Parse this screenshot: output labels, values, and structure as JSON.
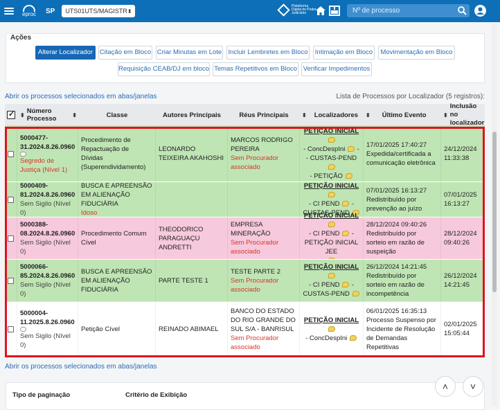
{
  "header": {
    "brand": "eproc",
    "uf": "SP",
    "unit_value": "UTS01UTS/MAGISTR",
    "pdpj_text": "Plataforma Digital do Poder Judiciário",
    "search_placeholder": "Nº de processo"
  },
  "acoes": {
    "title": "Ações",
    "buttons": [
      "Alterar Localizador",
      "Citação em Bloco",
      "Criar Minutas em Lote",
      "Incluir Lembretes em Bloco",
      "Intimação em Bloco",
      "Movimentação em Bloco",
      "Requisição CEAB/DJ em bloco",
      "Temas Repetitivos em Bloco",
      "Verificar Impedimentos"
    ]
  },
  "links": {
    "open_tabs": "Abrir os processos selecionados em abas/janelas"
  },
  "list_count": "Lista de Processos por Localizador (5 registros):",
  "table": {
    "headers": {
      "numero": "Número Processo",
      "classe": "Classe",
      "autores": "Autores Principais",
      "reus": "Réus Principais",
      "localizadores": "Localizadores",
      "evento": "Último Evento",
      "inclusao": "Inclusão no localizador"
    },
    "rows": [
      {
        "num1": "5000477-",
        "num2": "31.2024.8.26.0960",
        "sigilo": "Segredo de Justiça (Nível 1)",
        "classe": "Procedimento de Repactuação de Dívidas (Superendividamento)",
        "classe_extra": "",
        "autor": "LEONARDO TEIXEIRA AKAHOSHI",
        "reu": "MARCOS RODRIGO PEREIRA",
        "reu_note": "Sem Procurador associado",
        "loc_title": "PETIÇÃO INICIAL",
        "loc_1": "- ConcDespIni",
        "loc_2": "- CUSTAS-PEND",
        "loc_3": "- PETIÇÃO",
        "evento": "17/01/2025 17:40:27 Expedida/certificada a comunicação eletrônica",
        "inclusao": "24/12/2024 11:33:38"
      },
      {
        "num1": "5000409-",
        "num2": "81.2024.8.26.0960",
        "sigilo": "Sem Sigilo (Nível 0)",
        "classe": "BUSCA E APREENSÃO EM ALIENAÇÃO FIDUCIÁRIA",
        "classe_extra": "Idoso",
        "autor": "",
        "reu": "",
        "reu_note": "",
        "loc_title": "PETIÇÃO INICIAL",
        "loc_1": "- CI PEND",
        "loc_2": "-",
        "loc_3": "CUSTAS-PEND",
        "evento": "07/01/2025 16:13:27 Redistribuído por prevenção ao juízo",
        "inclusao": "07/01/2025 16:13:27"
      },
      {
        "num1": "5000388-",
        "num2": "08.2024.8.26.0960",
        "sigilo": "Sem Sigilo (Nível 0)",
        "classe": "Procedimento Comum Cível",
        "classe_extra": "",
        "autor": "THEODORICO PARAGUAÇU ANDRETTI",
        "reu": "EMPRESA MINERAÇÃO",
        "reu_note": "Sem Procurador associado",
        "loc_title": "PETIÇÃO INICIAL",
        "loc_1": "- CI PEND",
        "loc_2": "-",
        "loc_3": "PETIÇÃO INICIAL JEE",
        "evento": "28/12/2024 09:40:26 Redistribuído por sorteio em razão de suspeição",
        "inclusao": "28/12/2024 09:40:26"
      },
      {
        "num1": "5000066-",
        "num2": "85.2024.8.26.0960",
        "sigilo": "Sem Sigilo (Nível 0)",
        "classe": "BUSCA E APREENSÃO EM ALIENAÇÃO FIDUCIÁRIA",
        "classe_extra": "",
        "autor": "PARTE TESTE 1",
        "reu": "TESTE PARTE 2",
        "reu_note": "Sem Procurador associado",
        "loc_title": "PETIÇÃO INICIAL",
        "loc_1": "- CI PEND",
        "loc_2": "-",
        "loc_3": "CUSTAS-PEND",
        "evento": "26/12/2024 14:21:45 Redistribuído por sorteio em razão de incompetência",
        "inclusao": "26/12/2024 14:21:45"
      },
      {
        "num1": "5000004-",
        "num2": "11.2025.8.26.0960",
        "sigilo": "Sem Sigilo (Nível 0)",
        "classe": "Petição Cível",
        "classe_extra": "",
        "autor": "REINADO ABIMAEL",
        "reu": "BANCO DO ESTADO DO RIO GRANDE DO SUL S/A - BANRISUL",
        "reu_note": "Sem Procurador associado",
        "loc_title": "PETIÇÃO INICIAL",
        "loc_1": "- ConcDespIni",
        "loc_2": "",
        "loc_3": "",
        "evento": "06/01/2025 16:35:13 Processo Suspenso por Incidente de Resolução de Demandas Repetitivas",
        "inclusao": "02/01/2025 15:05:44"
      }
    ]
  },
  "bottom": {
    "pagination_title": "Tipo de paginação",
    "criteria_title": "Critério de Exibição"
  },
  "colors": {
    "header_blue": "#0d6fb8",
    "row_green": "#bfe5b4",
    "row_pink": "#f7c9dc",
    "row_white": "#ffffff",
    "highlight_red": "#e0121b"
  }
}
